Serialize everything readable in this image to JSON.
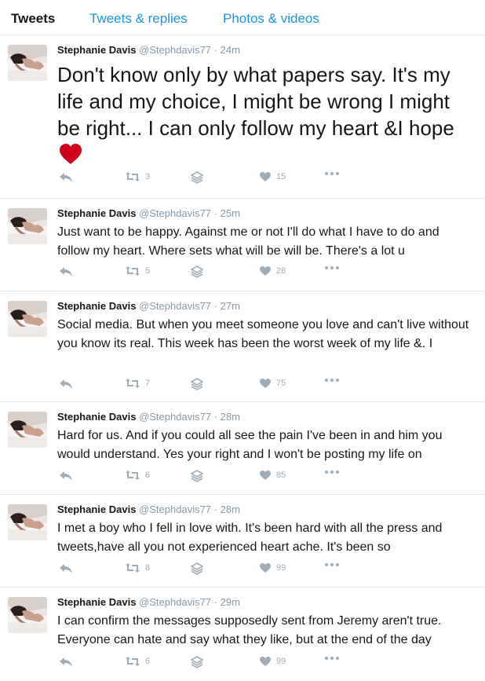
{
  "tabs": [
    {
      "label": "Tweets",
      "active": true
    },
    {
      "label": "Tweets & replies",
      "active": false
    },
    {
      "label": "Photos & videos",
      "active": false
    }
  ],
  "colors": {
    "link": "#1b95e0",
    "muted": "#8899a6",
    "icon": "#9fadb8",
    "heart": "#d0021b",
    "divider": "#e1e8ed"
  },
  "tweets": [
    {
      "name": "Stephanie Davis",
      "handle": "@Stephdavis77",
      "sep": "·",
      "time": "24m",
      "text": "Don't know only by what papers say. It's my life and my choice, I might be wrong I might be right... I can only follow my heart &I hope",
      "emoji": "heart-emoji",
      "retweets": "3",
      "likes": "15"
    },
    {
      "name": "Stephanie Davis",
      "handle": "@Stephdavis77",
      "sep": "·",
      "time": "25m",
      "text": "Just want to be happy. Against me or not I'll do what I have to do and follow my heart. Where sets what will be will be. There's a lot u",
      "retweets": "5",
      "likes": "28"
    },
    {
      "name": "Stephanie Davis",
      "handle": "@Stephdavis77",
      "sep": "·",
      "time": "27m",
      "text": "Social media. But when you meet someone you love and can't live without you know its real. This week has been the worst week of my life &. I",
      "retweets": "7",
      "likes": "75"
    },
    {
      "name": "Stephanie Davis",
      "handle": "@Stephdavis77",
      "sep": "·",
      "time": "28m",
      "text": "Hard for us. And if you could all see the pain I've been in and him you would understand. Yes your right and I won't be posting my life on",
      "retweets": "6",
      "likes": "85"
    },
    {
      "name": "Stephanie Davis",
      "handle": "@Stephdavis77",
      "sep": "·",
      "time": "28m",
      "text": "I met a boy who I fell in love with. It's been hard with all the press and tweets,have all you not experienced heart ache. It's been so",
      "retweets": "8",
      "likes": "99"
    },
    {
      "name": "Stephanie Davis",
      "handle": "@Stephdavis77",
      "sep": "·",
      "time": "29m",
      "text": "I can confirm the messages supposedly sent from Jeremy aren't true. Everyone can hate and say what they like, but at the end of the day",
      "retweets": "6",
      "likes": "99"
    }
  ]
}
